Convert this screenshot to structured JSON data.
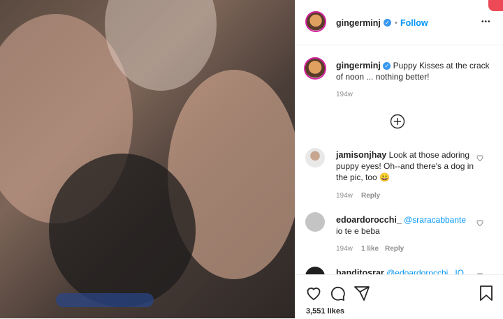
{
  "post": {
    "username": "gingerminj",
    "follow_label": "Follow",
    "dot": "•",
    "more_label": "•••",
    "caption": "Puppy Kisses at the crack of noon ... nothing better!",
    "caption_age": "194w",
    "likes": "3,551 likes"
  },
  "comments": [
    {
      "user": "jamisonjhay",
      "text": "Look at those adoring puppy eyes! Oh--and there's a dog in the pic, too 😀",
      "age": "194w",
      "likes": "",
      "reply": "Reply"
    },
    {
      "user": "edoardorocchi_",
      "mention": "@sraracabbante",
      "text": "io te e beba",
      "age": "194w",
      "likes": "1 like",
      "reply": "Reply"
    },
    {
      "user": "banditosrar",
      "mention": "@edoardorocchi_ IO",
      "text": "",
      "age": "",
      "likes": "",
      "reply": ""
    }
  ],
  "icons": {
    "verified": "verified-icon",
    "add": "add-circle-icon",
    "like": "heart-icon",
    "comment": "comment-icon",
    "share": "share-icon",
    "save": "bookmark-icon"
  },
  "colors": {
    "accent": "#0095f6",
    "notification": "#ed4956"
  }
}
